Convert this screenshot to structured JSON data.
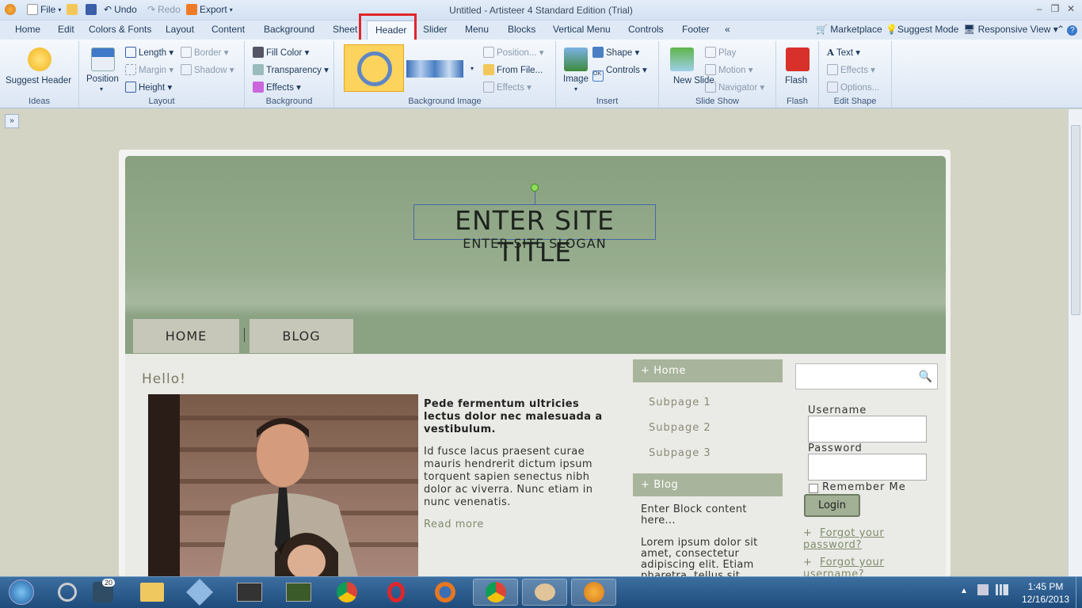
{
  "titlebar": {
    "file": "File",
    "undo": "Undo",
    "redo": "Redo",
    "export": "Export",
    "title": "Untitled - Artisteer 4 Standard Edition (Trial)"
  },
  "tabs": [
    "Home",
    "Edit",
    "Colors & Fonts",
    "Layout",
    "Content",
    "Background",
    "Sheet",
    "Header",
    "Slider",
    "Menu",
    "Blocks",
    "Vertical Menu",
    "Controls",
    "Footer",
    "«"
  ],
  "active_tab": "Header",
  "tabs_right": {
    "marketplace": "Marketplace",
    "suggest_mode": "Suggest Mode",
    "responsive_view": "Responsive View"
  },
  "ribbon": {
    "ideas": {
      "suggest": "Suggest Header",
      "label": "Ideas"
    },
    "layout": {
      "position": "Position",
      "length": "Length",
      "height": "Height",
      "border": "Border",
      "margin": "Margin",
      "shadow": "Shadow",
      "label": "Layout"
    },
    "background": {
      "fill": "Fill Color",
      "transparency": "Transparency",
      "effects": "Effects",
      "label": "Background"
    },
    "bgimage": {
      "position": "Position...",
      "fromfile": "From File...",
      "effects": "Effects",
      "label": "Background Image"
    },
    "insert": {
      "image": "Image",
      "shape": "Shape",
      "controls": "Controls",
      "label": "Insert"
    },
    "slideshow": {
      "newslide": "New Slide",
      "play": "Play",
      "motion": "Motion",
      "navigator": "Navigator",
      "label": "Slide Show"
    },
    "flash": {
      "flash": "Flash",
      "label": "Flash"
    },
    "editshape": {
      "text": "Text",
      "effects": "Effects",
      "options": "Options...",
      "label": "Edit Shape"
    }
  },
  "site": {
    "title": "ENTER SITE TITLE",
    "slogan": "ENTER SITE SLOGAN",
    "nav": [
      "HOME",
      "BLOG"
    ],
    "post_title": "Hello!",
    "article_title": "Pede fermentum ultricies lectus dolor nec malesuada a vestibulum.",
    "article_body": "Id fusce lacus praesent curae mauris hendrerit dictum ipsum torquent sapien senectus nibh dolor ac viverra. Nunc etiam in nunc venenatis.",
    "read_more": "Read more",
    "vmenu_home": "Home",
    "subpages": [
      "Subpage 1",
      "Subpage 2",
      "Subpage 3"
    ],
    "vmenu_blog": "Blog",
    "block_content": "Enter Block content here...",
    "block_lorem": "Lorem ipsum dolor sit amet, consectetur adipiscing elit. Etiam pharetra, tellus sit",
    "username": "Username",
    "password": "Password",
    "remember": "Remember Me",
    "login": "Login",
    "forgot_password": "Forgot your password?",
    "forgot_username": "Forgot your username?"
  },
  "taskbar": {
    "twitter_badge": "20",
    "time": "1:45 PM",
    "date": "12/16/2013"
  }
}
